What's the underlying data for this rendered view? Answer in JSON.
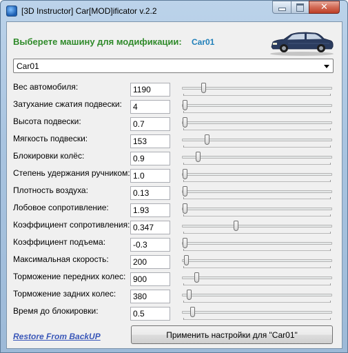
{
  "window": {
    "title": "[3D Instructor] Car[MOD]ificator v.2.2",
    "close_symbol": "✕"
  },
  "header": {
    "label": "Выберете машину для модификации:",
    "car_name": "Car01",
    "car_icon": "car-image"
  },
  "car_select": {
    "selected": "Car01"
  },
  "params": [
    {
      "label": "Вес автомобиля:",
      "value": "1190",
      "slider_pos": 0.13
    },
    {
      "label": "Затухание сжатия подвески:",
      "value": "4",
      "slider_pos": 0.0
    },
    {
      "label": "Высота подвески:",
      "value": "0.7",
      "slider_pos": 0.0
    },
    {
      "label": "Мягкость подвески:",
      "value": "153",
      "slider_pos": 0.15
    },
    {
      "label": "Блокировки колёс:",
      "value": "0.9",
      "slider_pos": 0.09
    },
    {
      "label": "Степень удержания ручником:",
      "value": "1.0",
      "slider_pos": 0.0
    },
    {
      "label": "Плотность воздуха:",
      "value": "0.13",
      "slider_pos": 0.0
    },
    {
      "label": "Лобовое сопротивление:",
      "value": "1.93",
      "slider_pos": 0.0
    },
    {
      "label": "Коэффициент сопротивления:",
      "value": "0.347",
      "slider_pos": 0.35
    },
    {
      "label": "Коэффициент подъема:",
      "value": "-0.3",
      "slider_pos": 0.0
    },
    {
      "label": "Максимальная скорость:",
      "value": "200",
      "slider_pos": 0.01
    },
    {
      "label": "Торможение передних колес:",
      "value": "900",
      "slider_pos": 0.08
    },
    {
      "label": "Торможение задних колес:",
      "value": "380",
      "slider_pos": 0.03
    },
    {
      "label": "Время до блокировки:",
      "value": "0.5",
      "slider_pos": 0.05
    }
  ],
  "footer": {
    "restore_label": "Restore From  BackUP",
    "apply_label": "Применить настройки для \"Car01\""
  },
  "colors": {
    "header_label": "#2f8a2a",
    "header_car": "#1f7fb9",
    "link": "#3a57b8",
    "car_body": "#2b3c5f"
  }
}
